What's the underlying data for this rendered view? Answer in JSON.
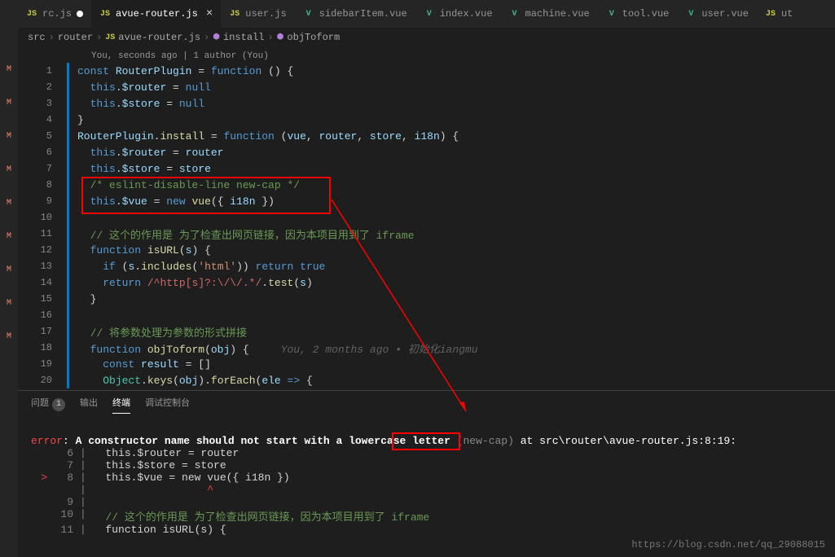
{
  "tabs": [
    {
      "icon": "js",
      "label": "rc.js",
      "active": false,
      "dirty": true
    },
    {
      "icon": "js",
      "label": "avue-router.js",
      "active": true,
      "dirty": false
    },
    {
      "icon": "js",
      "label": "user.js",
      "active": false,
      "dirty": false
    },
    {
      "icon": "vue",
      "label": "sidebarItem.vue",
      "active": false,
      "dirty": false
    },
    {
      "icon": "vue",
      "label": "index.vue",
      "active": false,
      "dirty": false
    },
    {
      "icon": "vue",
      "label": "machine.vue",
      "active": false,
      "dirty": false
    },
    {
      "icon": "vue",
      "label": "tool.vue",
      "active": false,
      "dirty": false
    },
    {
      "icon": "vue",
      "label": "user.vue",
      "active": false,
      "dirty": false
    },
    {
      "icon": "js",
      "label": "ut",
      "active": false,
      "dirty": false
    }
  ],
  "breadcrumb": {
    "parts": [
      "src",
      "router",
      "avue-router.js",
      "install",
      "objToform"
    ],
    "sep": "›"
  },
  "codelens": "You, seconds ago | 1 author (You)",
  "leftbar": [
    "M",
    "M",
    "M",
    "M",
    "M",
    "M",
    "M",
    "M",
    "M"
  ],
  "code": {
    "l1": {
      "n": "1",
      "pre": "",
      "tokens": [
        [
          "k-const",
          "const "
        ],
        [
          "k-var",
          "RouterPlugin"
        ],
        [
          "k-punct",
          " = "
        ],
        [
          "k-keyword",
          "function"
        ],
        [
          "k-punct",
          " () {"
        ]
      ]
    },
    "l2": {
      "n": "2",
      "pre": "  ",
      "tokens": [
        [
          "k-this",
          "this"
        ],
        [
          "k-punct",
          "."
        ],
        [
          "k-prop",
          "$router"
        ],
        [
          "k-punct",
          " = "
        ],
        [
          "k-null",
          "null"
        ]
      ]
    },
    "l3": {
      "n": "3",
      "pre": "  ",
      "tokens": [
        [
          "k-this",
          "this"
        ],
        [
          "k-punct",
          "."
        ],
        [
          "k-prop",
          "$store"
        ],
        [
          "k-punct",
          " = "
        ],
        [
          "k-null",
          "null"
        ]
      ]
    },
    "l4": {
      "n": "4",
      "pre": "",
      "tokens": [
        [
          "k-punct",
          "}"
        ]
      ]
    },
    "l5": {
      "n": "5",
      "pre": "",
      "tokens": [
        [
          "k-var",
          "RouterPlugin"
        ],
        [
          "k-punct",
          "."
        ],
        [
          "k-func",
          "install"
        ],
        [
          "k-punct",
          " = "
        ],
        [
          "k-keyword",
          "function"
        ],
        [
          "k-punct",
          " ("
        ],
        [
          "k-param",
          "vue"
        ],
        [
          "k-punct",
          ", "
        ],
        [
          "k-param",
          "router"
        ],
        [
          "k-punct",
          ", "
        ],
        [
          "k-param",
          "store"
        ],
        [
          "k-punct",
          ", "
        ],
        [
          "k-param",
          "i18n"
        ],
        [
          "k-punct",
          ") {"
        ]
      ]
    },
    "l6": {
      "n": "6",
      "pre": "  ",
      "tokens": [
        [
          "k-this",
          "this"
        ],
        [
          "k-punct",
          "."
        ],
        [
          "k-prop",
          "$router"
        ],
        [
          "k-punct",
          " = "
        ],
        [
          "k-var",
          "router"
        ]
      ]
    },
    "l7": {
      "n": "7",
      "pre": "  ",
      "tokens": [
        [
          "k-this",
          "this"
        ],
        [
          "k-punct",
          "."
        ],
        [
          "k-prop",
          "$store"
        ],
        [
          "k-punct",
          " = "
        ],
        [
          "k-var",
          "store"
        ]
      ]
    },
    "l8": {
      "n": "8",
      "pre": "  ",
      "tokens": [
        [
          "k-comment",
          "/* eslint-disable-line new-cap */"
        ]
      ]
    },
    "l9": {
      "n": "9",
      "pre": "  ",
      "tokens": [
        [
          "k-this",
          "this"
        ],
        [
          "k-punct",
          "."
        ],
        [
          "k-prop",
          "$vue"
        ],
        [
          "k-punct",
          " = "
        ],
        [
          "k-keyword",
          "new"
        ],
        [
          "k-punct",
          " "
        ],
        [
          "k-func",
          "vue"
        ],
        [
          "k-punct",
          "({ "
        ],
        [
          "k-var",
          "i18n"
        ],
        [
          "k-punct",
          " })"
        ]
      ]
    },
    "l10": {
      "n": "10",
      "pre": "",
      "tokens": []
    },
    "l11": {
      "n": "11",
      "pre": "  ",
      "tokens": [
        [
          "k-comment",
          "// 这个的作用是 为了检查出网页链接，因为本项目用到了 iframe"
        ]
      ]
    },
    "l12": {
      "n": "12",
      "pre": "  ",
      "tokens": [
        [
          "k-keyword",
          "function"
        ],
        [
          "k-punct",
          " "
        ],
        [
          "k-func",
          "isURL"
        ],
        [
          "k-punct",
          "("
        ],
        [
          "k-param",
          "s"
        ],
        [
          "k-punct",
          ") {"
        ]
      ]
    },
    "l13": {
      "n": "13",
      "pre": "    ",
      "tokens": [
        [
          "k-keyword",
          "if"
        ],
        [
          "k-punct",
          " ("
        ],
        [
          "k-var",
          "s"
        ],
        [
          "k-punct",
          "."
        ],
        [
          "k-func",
          "includes"
        ],
        [
          "k-punct",
          "("
        ],
        [
          "k-string",
          "'html'"
        ],
        [
          "k-punct",
          ")) "
        ],
        [
          "k-keyword",
          "return"
        ],
        [
          "k-punct",
          " "
        ],
        [
          "k-null",
          "true"
        ]
      ]
    },
    "l14": {
      "n": "14",
      "pre": "    ",
      "tokens": [
        [
          "k-keyword",
          "return"
        ],
        [
          "k-punct",
          " "
        ],
        [
          "k-regex",
          "/^http[s]?:\\/\\/.*/"
        ],
        [
          "k-punct",
          "."
        ],
        [
          "k-func",
          "test"
        ],
        [
          "k-punct",
          "("
        ],
        [
          "k-var",
          "s"
        ],
        [
          "k-punct",
          ")"
        ]
      ]
    },
    "l15": {
      "n": "15",
      "pre": "  ",
      "tokens": [
        [
          "k-punct",
          "}"
        ]
      ]
    },
    "l16": {
      "n": "16",
      "pre": "",
      "tokens": []
    },
    "l17": {
      "n": "17",
      "pre": "  ",
      "tokens": [
        [
          "k-comment",
          "// 将参数处理为参数的形式拼接"
        ]
      ]
    },
    "l18": {
      "n": "18",
      "pre": "  ",
      "tokens": [
        [
          "k-keyword",
          "function"
        ],
        [
          "k-punct",
          " "
        ],
        [
          "k-func",
          "objToform"
        ],
        [
          "k-punct",
          "("
        ],
        [
          "k-param",
          "obj"
        ],
        [
          "k-punct",
          ") {"
        ],
        [
          "k-inline",
          "     You, 2 months ago • 初始化iangmu"
        ]
      ]
    },
    "l19": {
      "n": "19",
      "pre": "    ",
      "tokens": [
        [
          "k-const",
          "const"
        ],
        [
          "k-punct",
          " "
        ],
        [
          "k-var",
          "result"
        ],
        [
          "k-punct",
          " = []"
        ]
      ]
    },
    "l20": {
      "n": "20",
      "pre": "    ",
      "tokens": [
        [
          "k-type",
          "Object"
        ],
        [
          "k-punct",
          "."
        ],
        [
          "k-func",
          "keys"
        ],
        [
          "k-punct",
          "("
        ],
        [
          "k-var",
          "obj"
        ],
        [
          "k-punct",
          ")."
        ],
        [
          "k-func",
          "forEach"
        ],
        [
          "k-punct",
          "("
        ],
        [
          "k-var",
          "ele"
        ],
        [
          "k-punct",
          " "
        ],
        [
          "k-keyword",
          "=>"
        ],
        [
          "k-punct",
          " {"
        ]
      ]
    }
  },
  "panel": {
    "tabs": {
      "problems": "问题",
      "output": "输出",
      "terminal": "终端",
      "debug": "调试控制台",
      "badge": "1"
    }
  },
  "terminal": {
    "error_label": "error",
    "colon": ": ",
    "msg": "A constructor name should not start with a lowercase letter ",
    "rule": "(new-cap)",
    "at": " at ",
    "loc": "src\\router\\avue-router.js:8:19",
    "colon2": ":",
    "lines": [
      {
        "n": "6",
        "code": "  this.$router = router"
      },
      {
        "n": "7",
        "code": "  this.$store = store"
      },
      {
        "n": "8",
        "code": "  this.$vue = new vue({ i18n })",
        "marker": ">"
      },
      {
        "n": "",
        "code": "                  ^",
        "caret": true
      },
      {
        "n": "9",
        "code": ""
      },
      {
        "n": "10",
        "code": "  // 这个的作用是 为了检查出网页链接，因为本项目用到了 iframe",
        "comment": true
      },
      {
        "n": "11",
        "code": "  function isURL(s) {"
      }
    ]
  },
  "watermark": "https://blog.csdn.net/qq_29088015"
}
